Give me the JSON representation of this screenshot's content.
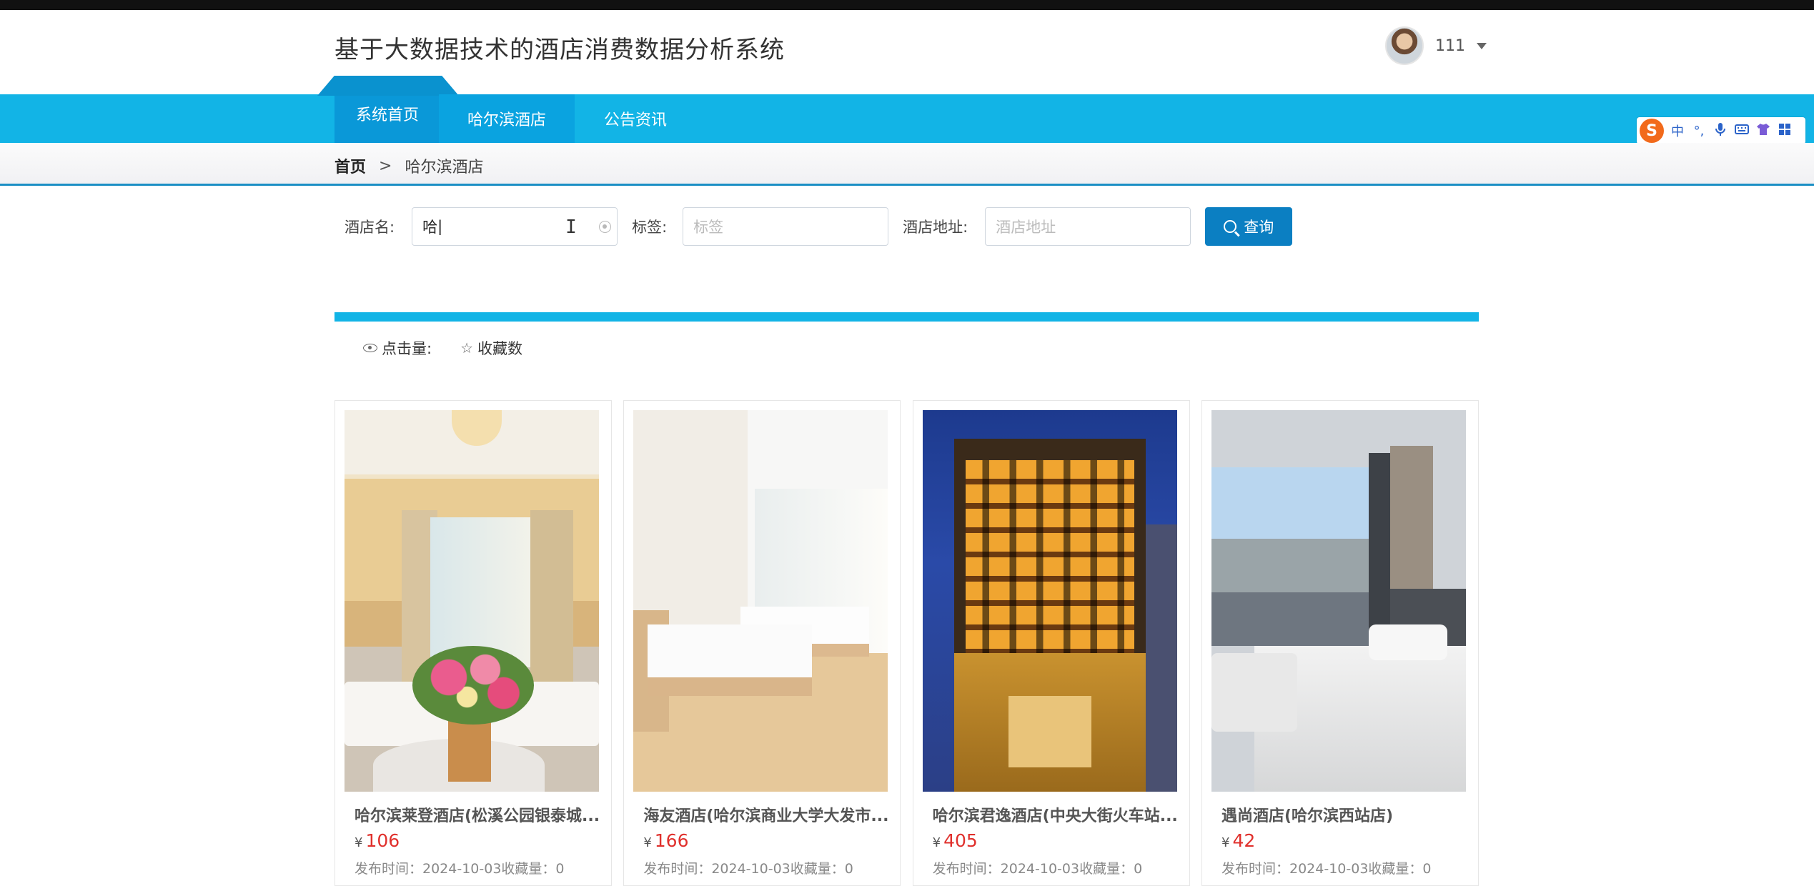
{
  "header": {
    "site_title": "基于大数据技术的酒店消费数据分析系统",
    "user_name": "111"
  },
  "nav": {
    "items": [
      {
        "label": "系统首页"
      },
      {
        "label": "哈尔滨酒店"
      },
      {
        "label": "公告资讯"
      }
    ]
  },
  "ime": {
    "logo": "S",
    "mode": "中",
    "punct": "°,"
  },
  "breadcrumb": {
    "home": "首页",
    "separator": ">",
    "current": "哈尔滨酒店"
  },
  "search": {
    "name_label": "酒店名:",
    "name_value": "哈",
    "tag_label": "标签:",
    "tag_placeholder": "标签",
    "address_label": "酒店地址:",
    "address_placeholder": "酒店地址",
    "button_label": "查询"
  },
  "sort": {
    "clicks_label": "点击量:",
    "favorites_label": "收藏数"
  },
  "currency_symbol": "¥",
  "hotels": [
    {
      "name": "哈尔滨莱登酒店(松溪公园银泰城...",
      "price": "106",
      "meta": "发布时间：2024-10-03收藏量：0"
    },
    {
      "name": "海友酒店(哈尔滨商业大学大发市...",
      "price": "166",
      "meta": "发布时间：2024-10-03收藏量：0"
    },
    {
      "name": "哈尔滨君逸酒店(中央大街火车站...",
      "price": "405",
      "meta": "发布时间：2024-10-03收藏量：0"
    },
    {
      "name": "遇尚酒店(哈尔滨西站店)",
      "price": "42",
      "meta": "发布时间：2024-10-03收藏量：0"
    }
  ],
  "colors": {
    "nav_bg": "#12b4e6",
    "nav_active": "#0a98d8",
    "button": "#0b7fc2",
    "price": "#e0302c"
  }
}
